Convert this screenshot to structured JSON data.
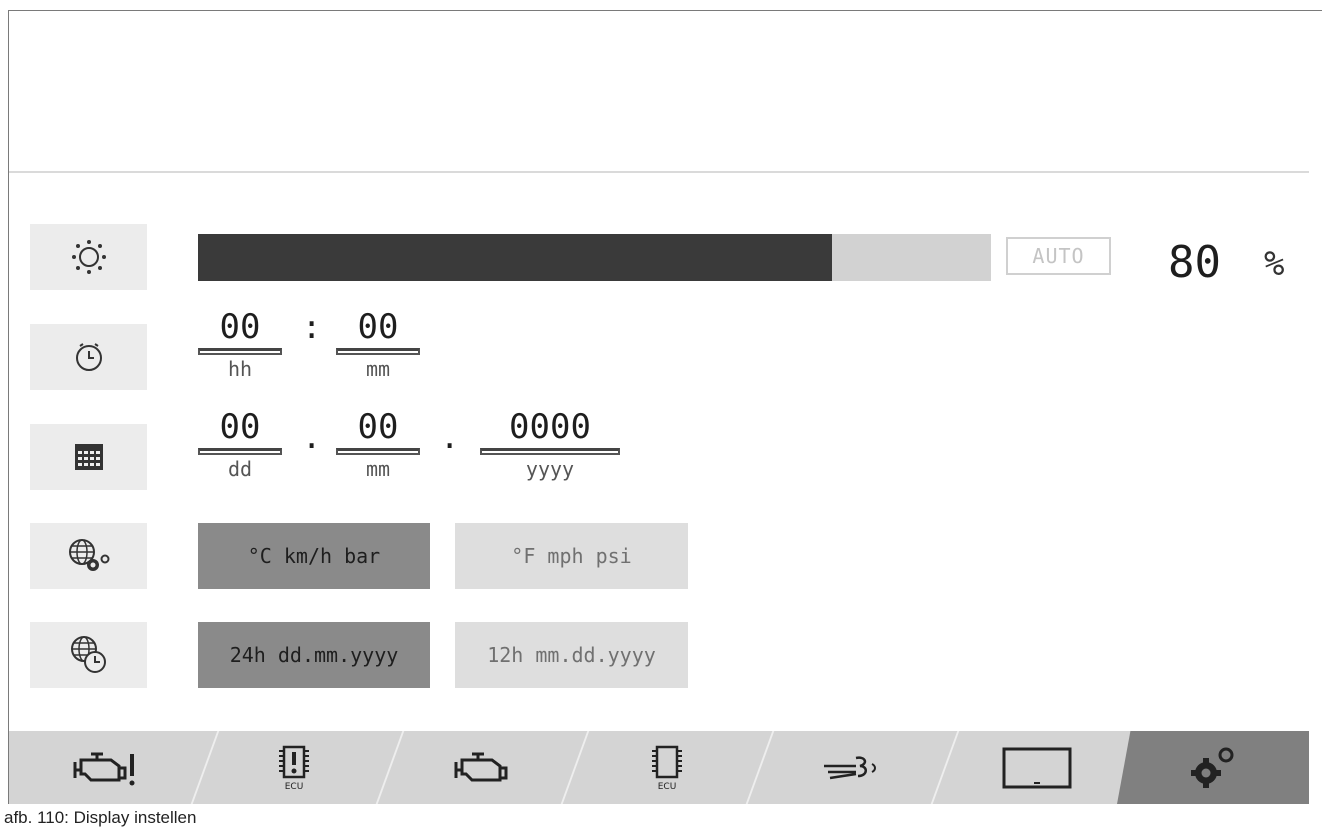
{
  "brightness": {
    "auto_label": "AUTO",
    "value": "80",
    "unit": "%",
    "level": 0.8
  },
  "time": {
    "hours": "00",
    "separator": ":",
    "minutes": "00",
    "hours_unit": "hh",
    "minutes_unit": "mm"
  },
  "date": {
    "day": "00",
    "separator1": ".",
    "month": "00",
    "separator2": ".",
    "year": "0000",
    "day_unit": "dd",
    "month_unit": "mm",
    "year_unit": "yyyy"
  },
  "units": {
    "metric": "°C km/h bar",
    "imperial": "°F mph psi",
    "selected": "metric"
  },
  "format": {
    "option_24h": "24h dd.mm.yyyy",
    "option_12h": "12h mm.dd.yyyy",
    "selected": "24h"
  },
  "icons": {
    "row1": "brightness-icon",
    "row2": "clock-icon",
    "row3": "calendar-icon",
    "row4": "units-settings-icon",
    "row5": "time-format-icon"
  },
  "tabs": [
    {
      "name": "engine-warning-icon",
      "active": false
    },
    {
      "name": "ecu-warning-icon",
      "active": false
    },
    {
      "name": "engine-icon",
      "active": false
    },
    {
      "name": "ecu-icon",
      "active": false
    },
    {
      "name": "exhaust-icon",
      "active": false
    },
    {
      "name": "display-icon",
      "active": false
    },
    {
      "name": "settings-icon",
      "active": true
    }
  ],
  "caption": "afb. 110: Display instellen",
  "colors": {
    "selected": "#8a8a8a",
    "unselected": "#dedede",
    "bar_fill": "#3a3a3a",
    "bar_track": "#d2d2d2"
  }
}
